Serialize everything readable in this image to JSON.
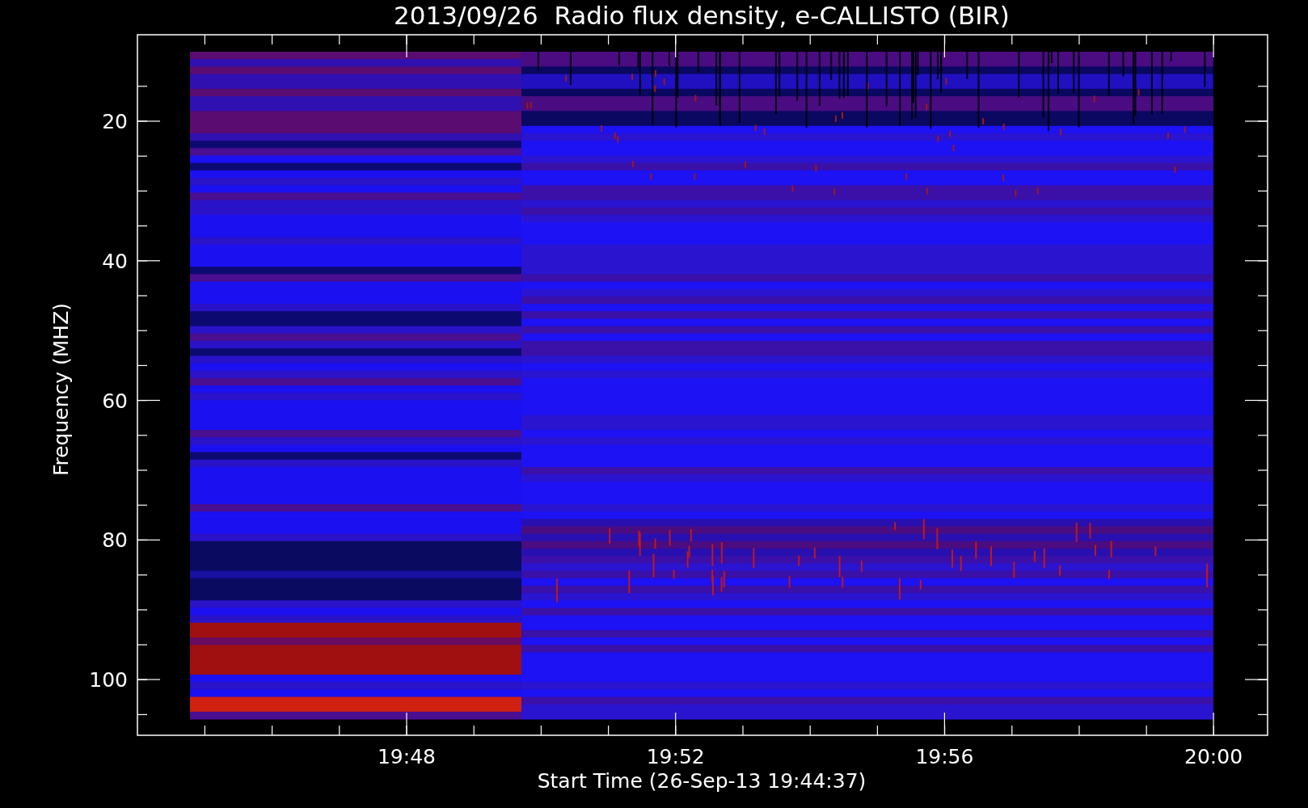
{
  "title": "2013/09/26  Radio flux density, e-CALLISTO (BIR)",
  "y_axis": {
    "label": "Frequency (MHZ)",
    "ticks": [
      "20",
      "40",
      "60",
      "80",
      "100"
    ]
  },
  "x_axis": {
    "label": "Start Time (26-Sep-13 19:44:37)",
    "ticks": [
      "19:48",
      "19:52",
      "19:56",
      "20:00"
    ]
  }
}
